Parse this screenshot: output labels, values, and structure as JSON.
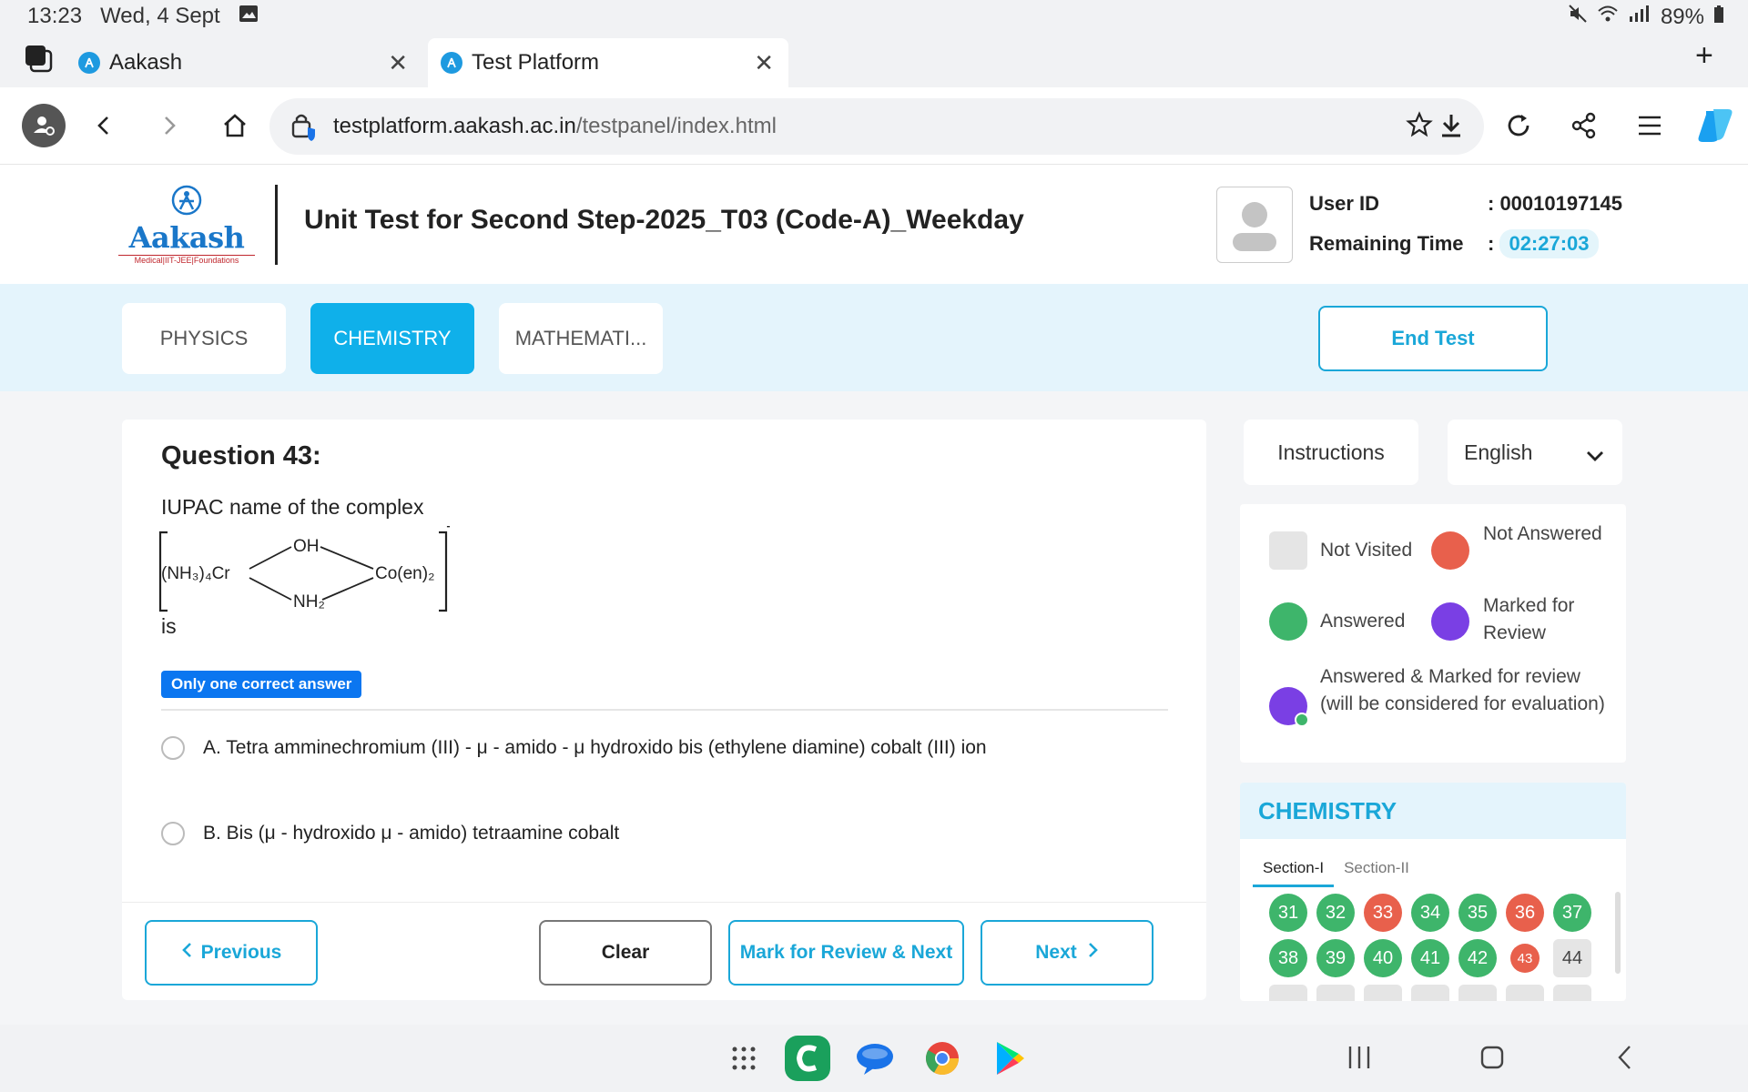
{
  "status_bar": {
    "time": "13:23",
    "date": "Wed, 4 Sept",
    "battery": "89%"
  },
  "browser": {
    "tabs": [
      {
        "title": "Aakash",
        "active": false
      },
      {
        "title": "Test Platform",
        "active": true
      }
    ],
    "url": {
      "domain": "testplatform.aakash.ac.in",
      "path": "/testpanel/index.html"
    }
  },
  "header": {
    "logo_text": "Aakash",
    "logo_tagline": "Medical|IIT-JEE|Foundations",
    "test_title": "Unit Test for Second Step-2025_T03 (Code-A)_Weekday",
    "user_id_label": "User ID",
    "user_id_value": ": 00010197145",
    "remaining_time_label": "Remaining Time",
    "remaining_time_colon": ":",
    "remaining_time_value": "02:27:03"
  },
  "subjects": [
    {
      "label": "PHYSICS",
      "active": false
    },
    {
      "label": "CHEMISTRY",
      "active": true
    },
    {
      "label": "MATHEMATI...",
      "active": false
    }
  ],
  "end_test_label": "End Test",
  "question": {
    "number_label": "Question 43:",
    "text": "IUPAC name of the complex",
    "text_after": "is",
    "structure": {
      "left": "(NH₃)₄Cr",
      "bridge_top": "OH",
      "bridge_bottom": "NH₂",
      "right": "Co(en)₂",
      "charge": "+4"
    },
    "answer_type_badge": "Only one correct answer",
    "options": [
      {
        "label": "A. Tetra amminechromium (III) - μ - amido - μ hydroxido bis (ethylene diamine) cobalt (III) ion"
      },
      {
        "label": "B. Bis (μ - hydroxido μ - amido) tetraamine cobalt"
      }
    ]
  },
  "actions": {
    "previous": "Previous",
    "clear": "Clear",
    "mark_review_next": "Mark for Review & Next",
    "next": "Next"
  },
  "side": {
    "instructions": "Instructions",
    "language": "English"
  },
  "legend": {
    "not_visited": "Not Visited",
    "not_answered": "Not Answered",
    "answered": "Answered",
    "marked_for_review": "Marked for Review",
    "answered_marked": "Answered & Marked for review (will be considered for evaluation)",
    "colors": {
      "not_visited": "#e5e5e5",
      "not_answered": "#e8604c",
      "answered": "#3eb56b",
      "marked": "#7a3fe4"
    }
  },
  "palette": {
    "subject": "CHEMISTRY",
    "sections": [
      "Section-I",
      "Section-II"
    ],
    "questions": [
      {
        "n": "31",
        "status": "answered"
      },
      {
        "n": "32",
        "status": "answered"
      },
      {
        "n": "33",
        "status": "not_answered"
      },
      {
        "n": "34",
        "status": "answered"
      },
      {
        "n": "35",
        "status": "answered"
      },
      {
        "n": "36",
        "status": "not_answered"
      },
      {
        "n": "37",
        "status": "answered"
      },
      {
        "n": "38",
        "status": "answered"
      },
      {
        "n": "39",
        "status": "answered"
      },
      {
        "n": "40",
        "status": "answered"
      },
      {
        "n": "41",
        "status": "answered"
      },
      {
        "n": "42",
        "status": "answered"
      },
      {
        "n": "43",
        "status": "current"
      },
      {
        "n": "44",
        "status": "not_visited"
      }
    ]
  }
}
